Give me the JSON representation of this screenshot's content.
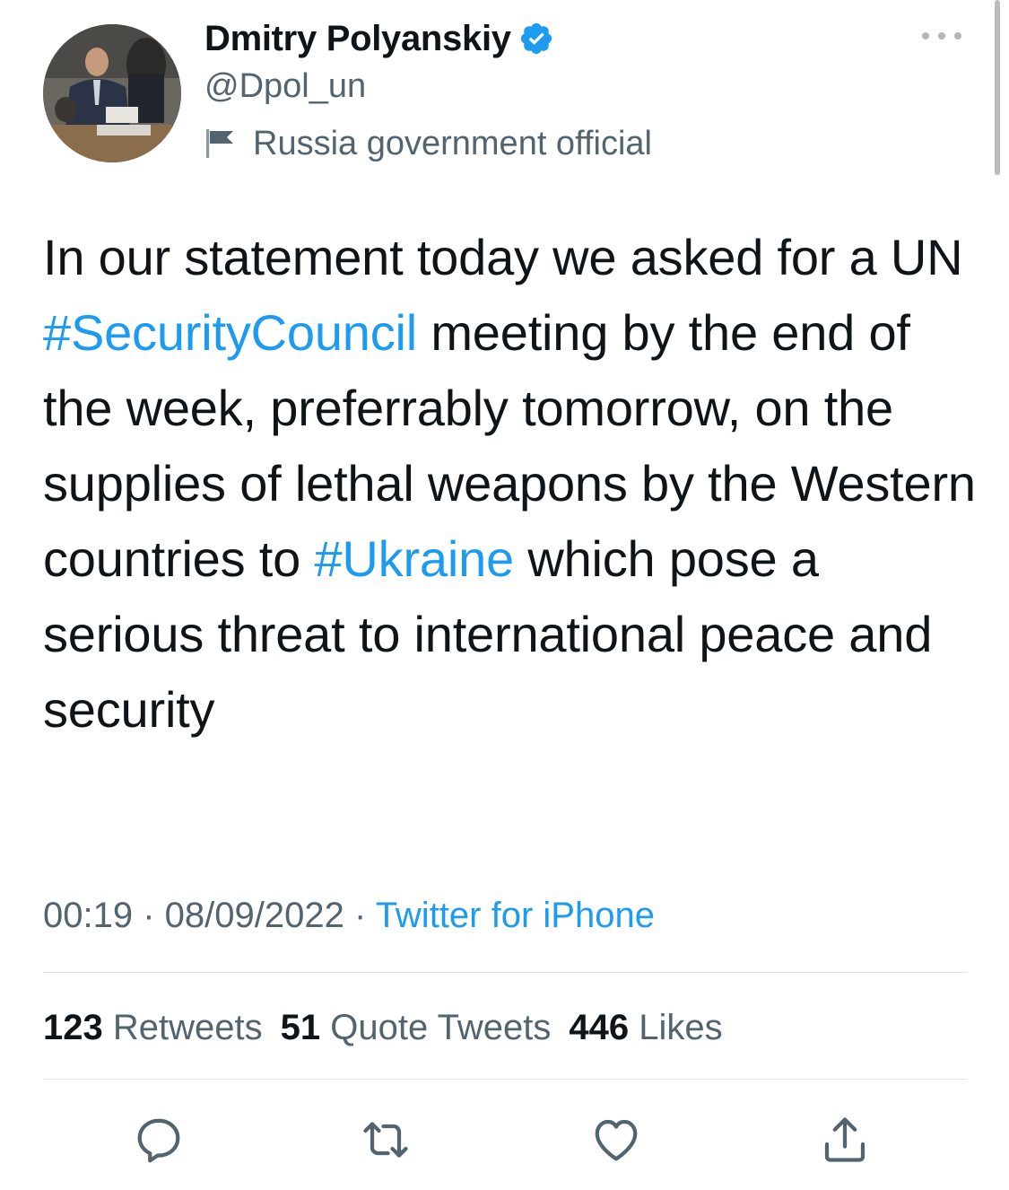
{
  "author": {
    "display_name": "Dmitry Polyanskiy",
    "handle": "@Dpol_un",
    "label": "Russia government official",
    "verified": true
  },
  "tweet": {
    "segments": [
      {
        "text": "In our statement today we asked for a UN ",
        "type": "text"
      },
      {
        "text": "#SecurityCouncil",
        "type": "hashtag"
      },
      {
        "text": " meeting by the end of the week, preferrably tomorrow, on the supplies of lethal weapons by the Western countries to ",
        "type": "text"
      },
      {
        "text": "#Ukraine",
        "type": "hashtag"
      },
      {
        "text": " which pose a serious threat to international peace and security",
        "type": "text"
      }
    ]
  },
  "meta": {
    "time": "00:19",
    "sep1": " · ",
    "date": "08/09/2022",
    "sep2": " · ",
    "source": "Twitter for iPhone"
  },
  "stats": {
    "retweets_count": "123",
    "retweets_label": "Retweets",
    "quotes_count": "51",
    "quotes_label": "Quote Tweets",
    "likes_count": "446",
    "likes_label": "Likes"
  },
  "icons": {
    "reply": "reply-icon",
    "retweet": "retweet-icon",
    "like": "heart-icon",
    "share": "share-icon",
    "more": "more-icon",
    "verified": "verified-badge-icon",
    "label": "flag-icon"
  },
  "colors": {
    "accent": "#1d9bf0",
    "text": "#0f1419",
    "secondary": "#536471"
  }
}
